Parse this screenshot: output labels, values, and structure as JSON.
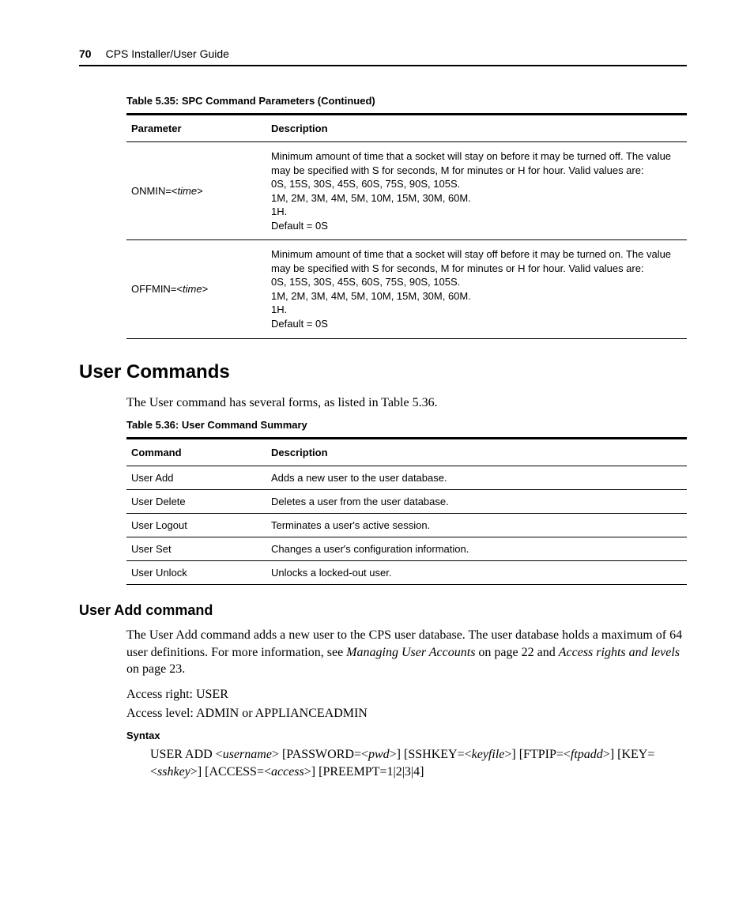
{
  "header": {
    "page_number": "70",
    "title": "CPS Installer/User Guide"
  },
  "table35": {
    "caption": "Table 5.35: SPC Command Parameters (Continued)",
    "columns": {
      "param": "Parameter",
      "desc": "Description"
    },
    "rows": [
      {
        "param_prefix": "ONMIN=<",
        "param_ital": "time",
        "param_suffix": ">",
        "desc_lines": [
          "Minimum amount of time that a socket will stay on before it may be turned off. The value may be specified with S for seconds, M for minutes or H for hour. Valid values are:",
          "0S, 15S, 30S, 45S, 60S, 75S, 90S, 105S.",
          "1M, 2M, 3M, 4M, 5M, 10M, 15M, 30M, 60M.",
          "1H.",
          "Default = 0S"
        ]
      },
      {
        "param_prefix": "OFFMIN=<",
        "param_ital": "time",
        "param_suffix": ">",
        "desc_lines": [
          "Minimum amount of time that a socket will stay off before it may be turned on. The value may be specified with S for seconds, M for minutes or H for hour. Valid values are:",
          "0S, 15S, 30S, 45S, 60S, 75S, 90S, 105S.",
          "1M, 2M, 3M, 4M, 5M, 10M, 15M, 30M, 60M.",
          "1H.",
          "Default = 0S"
        ]
      }
    ]
  },
  "section": {
    "heading": "User Commands",
    "intro": "The User command has several forms, as listed in Table 5.36."
  },
  "table36": {
    "caption": "Table 5.36: User Command Summary",
    "columns": {
      "cmd": "Command",
      "desc": "Description"
    },
    "rows": [
      {
        "cmd": "User Add",
        "desc": "Adds a new user to the user database."
      },
      {
        "cmd": "User Delete",
        "desc": "Deletes a user from the user database."
      },
      {
        "cmd": "User Logout",
        "desc": "Terminates a user's active session."
      },
      {
        "cmd": "User Set",
        "desc": "Changes a user's configuration information."
      },
      {
        "cmd": "User Unlock",
        "desc": "Unlocks a locked-out user."
      }
    ]
  },
  "useradd": {
    "heading": "User Add command",
    "para1_a": "The User Add command adds a new user to the CPS user database. The user database holds a maximum of 64 user definitions. For more information, see ",
    "para1_ital1": "Managing User Accounts",
    "para1_b": " on page 22 and ",
    "para1_ital2": "Access rights and levels",
    "para1_c": " on page 23.",
    "access_right": "Access right: USER",
    "access_level": "Access level: ADMIN or APPLIANCEADMIN",
    "syntax_label": "Syntax",
    "syntax": {
      "s1": "USER ADD <",
      "i1": "username",
      "s2": "> [PASSWORD=<",
      "i2": "pwd",
      "s3": ">] [SSHKEY=<",
      "i3": "keyfile",
      "s4": ">] [FTPIP=<",
      "i4": "ftpadd",
      "s5": ">] [KEY=<",
      "i5": "sshkey",
      "s6": ">] [ACCESS=<",
      "i6": "access",
      "s7": ">] [PREEMPT=1|2|3|4]"
    }
  }
}
